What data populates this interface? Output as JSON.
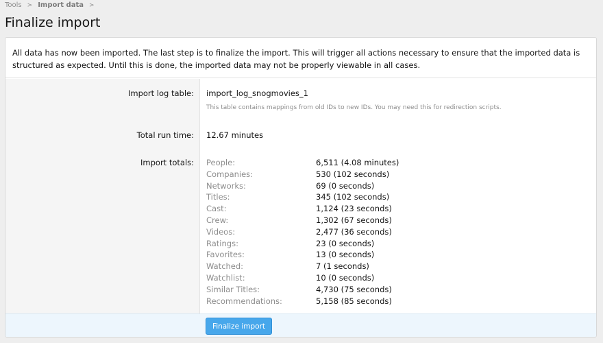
{
  "breadcrumb": {
    "items": [
      "Tools",
      "Import data"
    ],
    "separator": ">"
  },
  "page_title": "Finalize import",
  "intro_text": "All data has now been imported. The last step is to finalize the import. This will trigger all actions necessary to ensure that the imported data is structured as expected. Until this is done, the imported data may not be properly viewable in all cases.",
  "fields": {
    "log_table": {
      "label": "Import log table:",
      "value": "import_log_snogmovies_1",
      "hint": "This table contains mappings from old IDs to new IDs. You may need this for redirection scripts."
    },
    "run_time": {
      "label": "Total run time:",
      "value": "12.67 minutes"
    },
    "totals": {
      "label": "Import totals:",
      "rows": [
        {
          "name": "People:",
          "amount": "6,511 (4.08 minutes)"
        },
        {
          "name": "Companies:",
          "amount": "530 (102 seconds)"
        },
        {
          "name": "Networks:",
          "amount": "69 (0 seconds)"
        },
        {
          "name": "Titles:",
          "amount": "345 (102 seconds)"
        },
        {
          "name": "Cast:",
          "amount": "1,124 (23 seconds)"
        },
        {
          "name": "Crew:",
          "amount": "1,302 (67 seconds)"
        },
        {
          "name": "Videos:",
          "amount": "2,477 (36 seconds)"
        },
        {
          "name": "Ratings:",
          "amount": "23 (0 seconds)"
        },
        {
          "name": "Favorites:",
          "amount": "13 (0 seconds)"
        },
        {
          "name": "Watched:",
          "amount": "7 (1 seconds)"
        },
        {
          "name": "Watchlist:",
          "amount": "10 (0 seconds)"
        },
        {
          "name": "Similar Titles:",
          "amount": "4,730 (75 seconds)"
        },
        {
          "name": "Recommendations:",
          "amount": "5,158 (85 seconds)"
        }
      ]
    }
  },
  "footer": {
    "finalize_label": "Finalize import"
  },
  "colors": {
    "accent": "#47a7eb",
    "label_column_bg": "#f5f5f5",
    "footer_bg": "#edf6fd"
  }
}
